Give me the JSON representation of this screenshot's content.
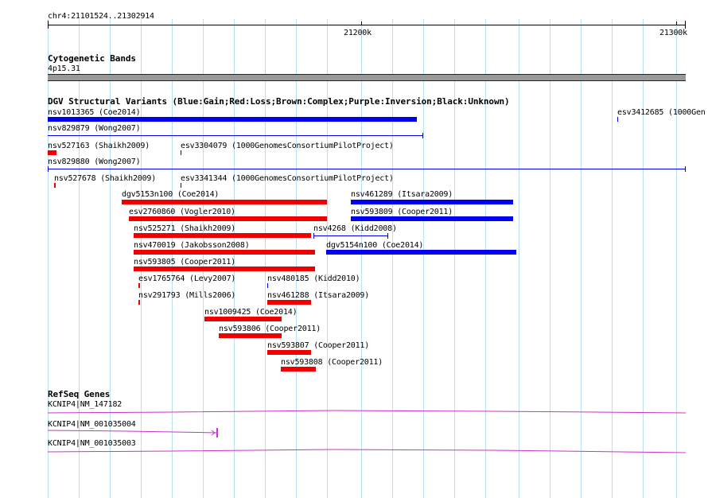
{
  "location": "chr4:21101524..21302914",
  "ruler": {
    "labels": [
      "21200k",
      "21300k"
    ]
  },
  "colors": {
    "gain": "#0000ee",
    "loss": "#ee0000",
    "refseq": "#cc33cc",
    "band": "#999999",
    "grid": "#b9e0f2"
  },
  "tracks": {
    "cytoband": {
      "title": "Cytogenetic Bands",
      "band": "4p15.31"
    },
    "dgv": {
      "title": "DGV Structural Variants (Blue:Gain;Red:Loss;Brown:Complex;Purple:Inversion;Black:Unknown)",
      "features": [
        "nsv1013365 (Coe2014)",
        "esv3412685 (1000Gen",
        "nsv829879 (Wong2007)",
        "nsv527163 (Shaikh2009)",
        "esv3304079 (1000GenomesConsortiumPilotProject)",
        "nsv829880 (Wong2007)",
        "nsv527678 (Shaikh2009)",
        "esv3341344 (1000GenomesConsortiumPilotProject)",
        "dgv5153n100 (Coe2014)",
        "nsv461289 (Itsara2009)",
        "esv2760860 (Vogler2010)",
        "nsv593809 (Cooper2011)",
        "nsv525271 (Shaikh2009)",
        "nsv4268 (Kidd2008)",
        "nsv470019 (Jakobsson2008)",
        "dgv5154n100 (Coe2014)",
        "nsv593805 (Cooper2011)",
        "esv1765764 (Levy2007)",
        "nsv480185 (Kidd2010)",
        "nsv291793 (Mills2006)",
        "nsv461288 (Itsara2009)",
        "nsv1009425 (Coe2014)",
        "nsv593806 (Cooper2011)",
        "nsv593807 (Cooper2011)",
        "nsv593808 (Cooper2011)"
      ]
    },
    "refseq": {
      "title": "RefSeq Genes",
      "genes": [
        "KCNIP4|NM_147182",
        "KCNIP4|NM_001035004",
        "KCNIP4|NM_001035003"
      ]
    }
  }
}
